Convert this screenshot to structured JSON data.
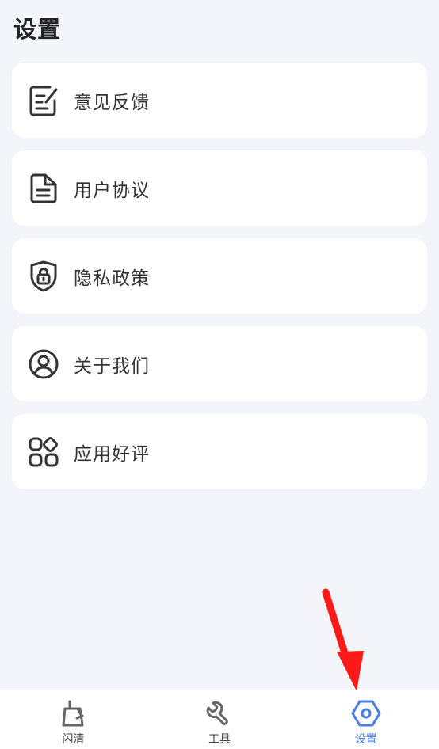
{
  "header": {
    "title": "设置"
  },
  "menu": {
    "items": [
      {
        "label": "意见反馈",
        "icon": "feedback-edit-icon"
      },
      {
        "label": "用户协议",
        "icon": "document-icon"
      },
      {
        "label": "隐私政策",
        "icon": "shield-lock-icon"
      },
      {
        "label": "关于我们",
        "icon": "user-circle-icon"
      },
      {
        "label": "应用好评",
        "icon": "apps-grid-icon"
      }
    ]
  },
  "tabbar": {
    "tabs": [
      {
        "label": "闪清",
        "icon": "broom-clean-icon",
        "active": false
      },
      {
        "label": "工具",
        "icon": "wrench-tool-icon",
        "active": false
      },
      {
        "label": "设置",
        "icon": "settings-hexagon-icon",
        "active": true
      }
    ]
  },
  "colors": {
    "active": "#4a7fe0",
    "background": "#f4f5fa",
    "annotation": "#ff1a1a"
  }
}
